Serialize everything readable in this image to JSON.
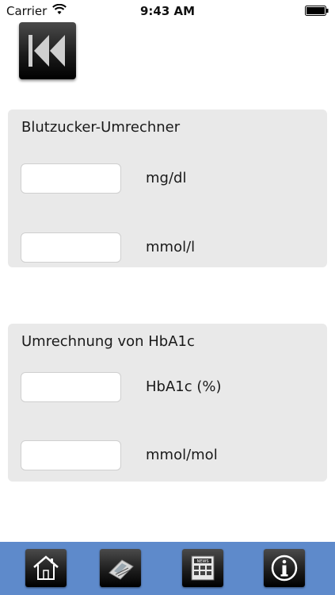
{
  "status": {
    "carrier": "Carrier",
    "time": "9:43 AM"
  },
  "icons": {
    "back": "rewind-icon",
    "home": "home-icon",
    "calculator": "calculator-icon",
    "news": "news-icon",
    "info": "info-icon"
  },
  "blood_sugar": {
    "title": "Blutzucker-Umrechner",
    "mgdl_value": "",
    "mgdl_unit": "mg/dl",
    "mmol_value": "",
    "mmol_unit": "mmol/l"
  },
  "hba1c": {
    "title": "Umrechnung von HbA1c",
    "percent_value": "",
    "percent_unit": "HbA1c (%)",
    "mmolmol_value": "",
    "mmolmol_unit": "mmol/mol"
  },
  "tabbar": {
    "background": "#5e8acb",
    "news_label": "NEWS"
  }
}
